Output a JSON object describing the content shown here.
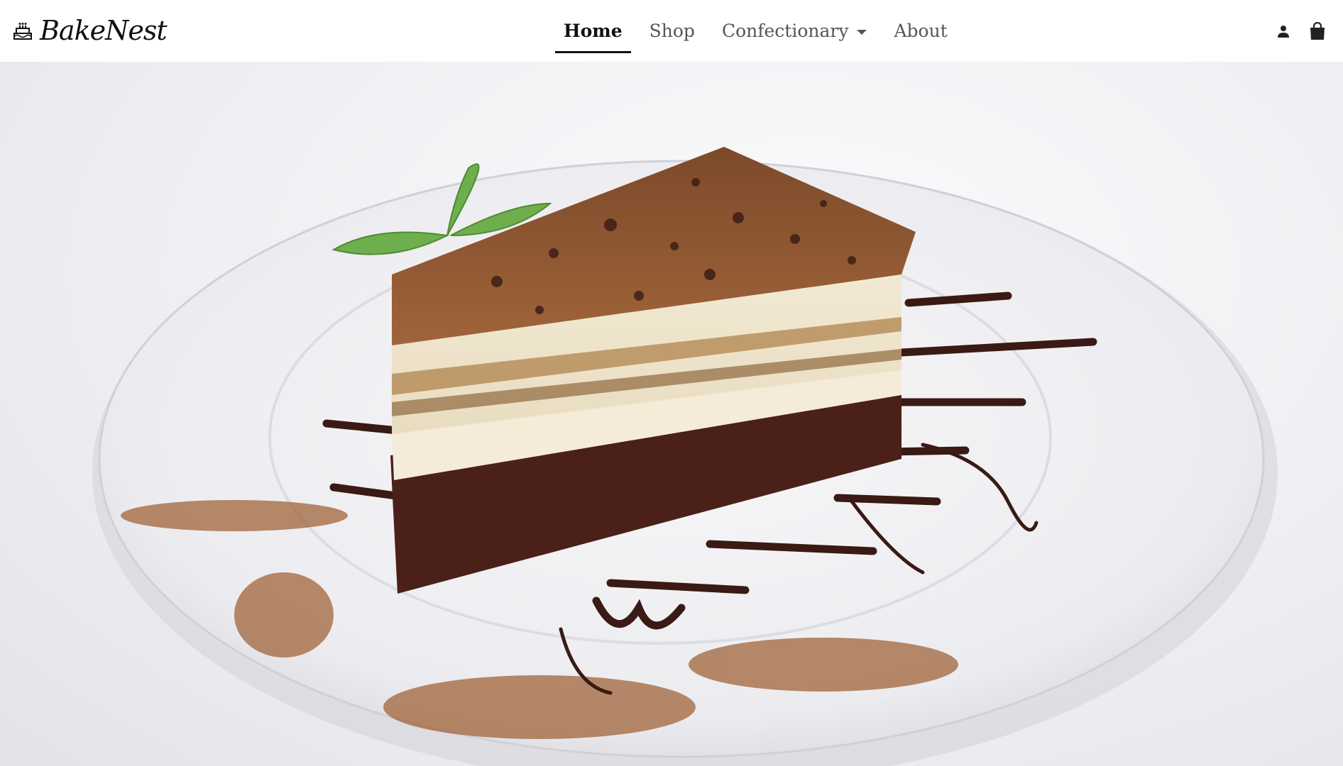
{
  "brand": {
    "name": "BakeNest",
    "icon": "cake-icon"
  },
  "nav": {
    "items": [
      {
        "label": "Home",
        "active": true
      },
      {
        "label": "Shop",
        "active": false
      },
      {
        "label": "Confectionary",
        "active": false,
        "has_dropdown": true
      },
      {
        "label": "About",
        "active": false
      }
    ]
  },
  "actions": {
    "account_icon": "user-icon",
    "cart_icon": "shopping-bag-icon"
  },
  "hero": {
    "image_subject": "tiramisu-cake-on-plate"
  },
  "colors": {
    "navbar_bg": "#ffffff",
    "active_text": "#111111",
    "inactive_text": "#555555",
    "chocolate": "#3a1a14",
    "cocoa": "#9b5a33"
  }
}
